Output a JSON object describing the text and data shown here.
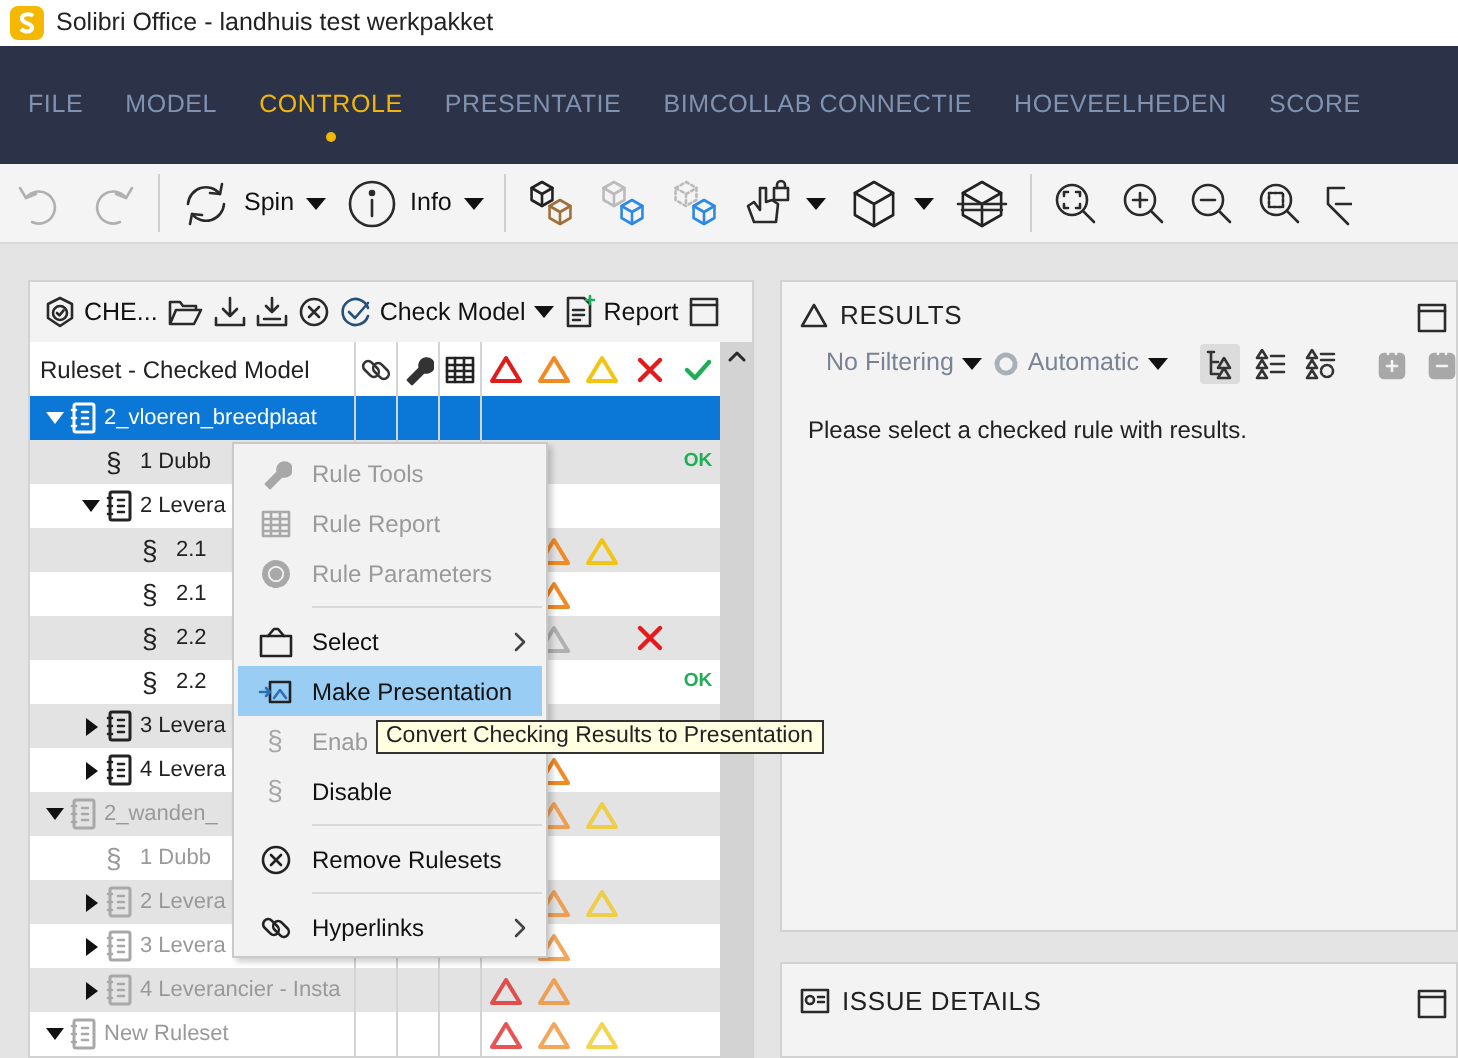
{
  "window": {
    "title": "Solibri Office - landhuis test werkpakket"
  },
  "menu_tabs": [
    {
      "label": "FILE",
      "selected": false
    },
    {
      "label": "MODEL",
      "selected": false
    },
    {
      "label": "CONTROLE",
      "selected": true
    },
    {
      "label": "PRESENTATIE",
      "selected": false
    },
    {
      "label": "BIMCOLLAB CONNECTIE",
      "selected": false
    },
    {
      "label": "HOEVEELHEDEN",
      "selected": false
    },
    {
      "label": "SCORE",
      "selected": false
    }
  ],
  "toolbar": [
    {
      "kind": "undo",
      "disabled": true
    },
    {
      "kind": "redo",
      "disabled": true
    },
    {
      "kind": "separator"
    },
    {
      "kind": "spin",
      "label": "Spin",
      "dropdown": true
    },
    {
      "kind": "info",
      "label": "Info",
      "dropdown": true
    },
    {
      "kind": "separator"
    },
    {
      "kind": "cubes"
    },
    {
      "kind": "cube-hidden"
    },
    {
      "kind": "cube-dashed"
    },
    {
      "kind": "hand-lock",
      "dropdown": true
    },
    {
      "kind": "cube",
      "dropdown": true
    },
    {
      "kind": "cube-section"
    },
    {
      "kind": "separator"
    },
    {
      "kind": "zoom-fit"
    },
    {
      "kind": "zoom-in"
    },
    {
      "kind": "zoom-out"
    },
    {
      "kind": "zoom-box"
    },
    {
      "kind": "select-cursor"
    }
  ],
  "checking_panel": {
    "title": "CHE...",
    "tools": [
      {
        "kind": "open"
      },
      {
        "kind": "import"
      },
      {
        "kind": "import-all"
      },
      {
        "kind": "close"
      },
      {
        "kind": "check",
        "label": "Check Model",
        "dropdown": true
      },
      {
        "kind": "report",
        "label": "Report"
      },
      {
        "kind": "window"
      }
    ],
    "tree_header": "Ruleset - Checked Model",
    "tree": [
      {
        "kind": "ruleset",
        "label": "2_vloeren_breedplaat",
        "expanded": true,
        "selected": true,
        "disabled": false,
        "children": [
          {
            "kind": "rule",
            "symbol": "§",
            "label": "1 Dubb",
            "selected": false,
            "disabled": false,
            "marks": [
              {
                "kind": "passed",
                "text": "OK"
              }
            ]
          },
          {
            "kind": "ruleset",
            "label": "2 Levera",
            "expanded": true,
            "selected": false,
            "disabled": false,
            "children": [
              {
                "kind": "rule",
                "symbol": "§",
                "label": "2.1",
                "selected": false,
                "disabled": false,
                "marks": [
                  {
                    "kind": "major"
                  },
                  {
                    "kind": "minor"
                  }
                ]
              },
              {
                "kind": "rule",
                "symbol": "§",
                "label": "2.1",
                "selected": false,
                "disabled": false,
                "marks": [
                  {
                    "kind": "major"
                  }
                ]
              },
              {
                "kind": "rule",
                "symbol": "§",
                "label": "2.2",
                "selected": false,
                "disabled": false,
                "marks": [
                  {
                    "kind": "unchecked"
                  },
                  {
                    "kind": "rejected"
                  }
                ]
              },
              {
                "kind": "rule",
                "symbol": "§",
                "label": "2.2",
                "selected": false,
                "disabled": false,
                "marks": [
                  {
                    "kind": "passed",
                    "text": "OK"
                  }
                ]
              }
            ]
          },
          {
            "kind": "ruleset",
            "label": "3 Levera",
            "expanded": false,
            "selected": false,
            "disabled": false
          },
          {
            "kind": "ruleset",
            "label": "4 Levera",
            "expanded": false,
            "selected": false,
            "disabled": false,
            "marks": [
              {
                "kind": "major"
              }
            ]
          }
        ]
      },
      {
        "kind": "ruleset",
        "label": "2_wanden_",
        "expanded": true,
        "selected": false,
        "disabled": true,
        "marks": [
          {
            "kind": "major"
          },
          {
            "kind": "minor"
          }
        ],
        "children": [
          {
            "kind": "rule",
            "symbol": "§",
            "label": "1 Dubb",
            "selected": false,
            "disabled": true
          },
          {
            "kind": "ruleset",
            "label": "2 Levera",
            "expanded": false,
            "selected": false,
            "disabled": true,
            "marks": [
              {
                "kind": "major"
              },
              {
                "kind": "minor"
              }
            ]
          },
          {
            "kind": "ruleset",
            "label": "3 Levera",
            "expanded": false,
            "selected": false,
            "disabled": true,
            "marks": [
              {
                "kind": "major"
              }
            ]
          },
          {
            "kind": "ruleset",
            "label": "4 Leverancier - Insta",
            "expanded": false,
            "selected": false,
            "disabled": true,
            "marks": [
              {
                "kind": "critical"
              },
              {
                "kind": "major"
              }
            ]
          }
        ]
      },
      {
        "kind": "ruleset",
        "label": "New Ruleset",
        "expanded": true,
        "selected": false,
        "disabled": true,
        "marks": [
          {
            "kind": "critical"
          },
          {
            "kind": "major"
          },
          {
            "kind": "minor"
          }
        ]
      }
    ]
  },
  "context_menu": {
    "items": [
      {
        "kind": "rule-tools",
        "label": "Rule Tools",
        "disabled": true,
        "selected": false,
        "submenu": false
      },
      {
        "kind": "rule-report",
        "label": "Rule Report",
        "disabled": true,
        "selected": false,
        "submenu": false
      },
      {
        "kind": "rule-parameters",
        "label": "Rule Parameters",
        "disabled": true,
        "selected": false,
        "submenu": false
      },
      {
        "kind": "separator"
      },
      {
        "kind": "select",
        "label": "Select",
        "disabled": false,
        "selected": false,
        "submenu": true
      },
      {
        "kind": "presentation",
        "label": "Make Presentation",
        "disabled": false,
        "selected": true,
        "submenu": false
      },
      {
        "kind": "enable",
        "symbol": "§",
        "label": "Enab",
        "disabled": true,
        "selected": false,
        "submenu": false
      },
      {
        "kind": "disable",
        "symbol": "§",
        "label": "Disable",
        "disabled": false,
        "selected": false,
        "submenu": false
      },
      {
        "kind": "separator"
      },
      {
        "kind": "remove",
        "label": "Remove Rulesets",
        "disabled": false,
        "selected": false,
        "submenu": false
      },
      {
        "kind": "separator"
      },
      {
        "kind": "hyperlinks",
        "label": "Hyperlinks",
        "disabled": false,
        "selected": false,
        "submenu": true
      }
    ]
  },
  "tooltip": {
    "text": "Convert Checking Results to Presentation"
  },
  "results_panel": {
    "title": "RESULTS",
    "filter": "No Filtering",
    "mode": "Automatic",
    "tools": [
      {
        "kind": "tree-view",
        "selected": true,
        "disabled": false
      },
      {
        "kind": "list-view",
        "selected": false,
        "disabled": false
      },
      {
        "kind": "list-settings",
        "selected": false,
        "disabled": false
      },
      {
        "kind": "separator"
      },
      {
        "kind": "bcf-add",
        "selected": false,
        "disabled": true
      },
      {
        "kind": "bcf-remove",
        "selected": false,
        "disabled": true
      }
    ],
    "message": "Please select a checked rule with results."
  },
  "issue_panel": {
    "title": "ISSUE DETAILS"
  }
}
